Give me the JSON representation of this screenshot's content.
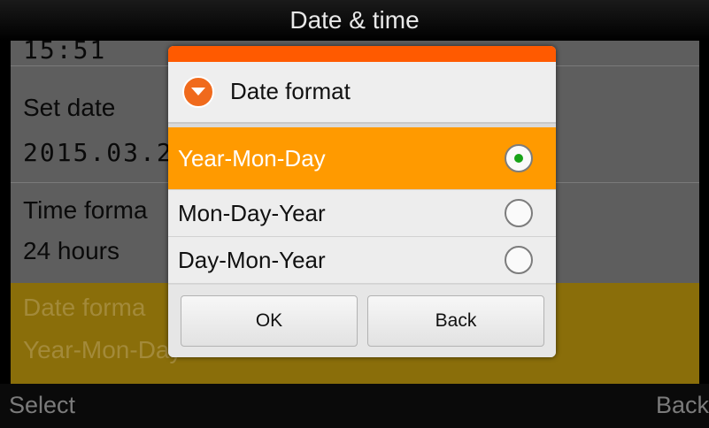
{
  "titlebar": {
    "title": "Date & time"
  },
  "list": {
    "time_value": "15:51",
    "set_date_label": "Set date",
    "date_value": "2015.03.2",
    "time_format_label": "Time forma",
    "time_format_value": "24 hours",
    "date_format_label": "Date forma",
    "date_format_value": "Year-Mon-Day"
  },
  "bottombar": {
    "left_softkey": "Select",
    "right_softkey": "Back"
  },
  "dialog": {
    "title": "Date format",
    "icon": "chevron-down-icon",
    "accent_color": "#ff5a00",
    "options": [
      {
        "label": "Year-Mon-Day",
        "selected": true
      },
      {
        "label": "Mon-Day-Year",
        "selected": false
      },
      {
        "label": "Day-Mon-Year",
        "selected": false
      }
    ],
    "ok_label": "OK",
    "back_label": "Back"
  },
  "colors": {
    "selection": "#ff9a00",
    "radio_dot": "#17a317",
    "highlight_row": "#8a6e0a"
  }
}
